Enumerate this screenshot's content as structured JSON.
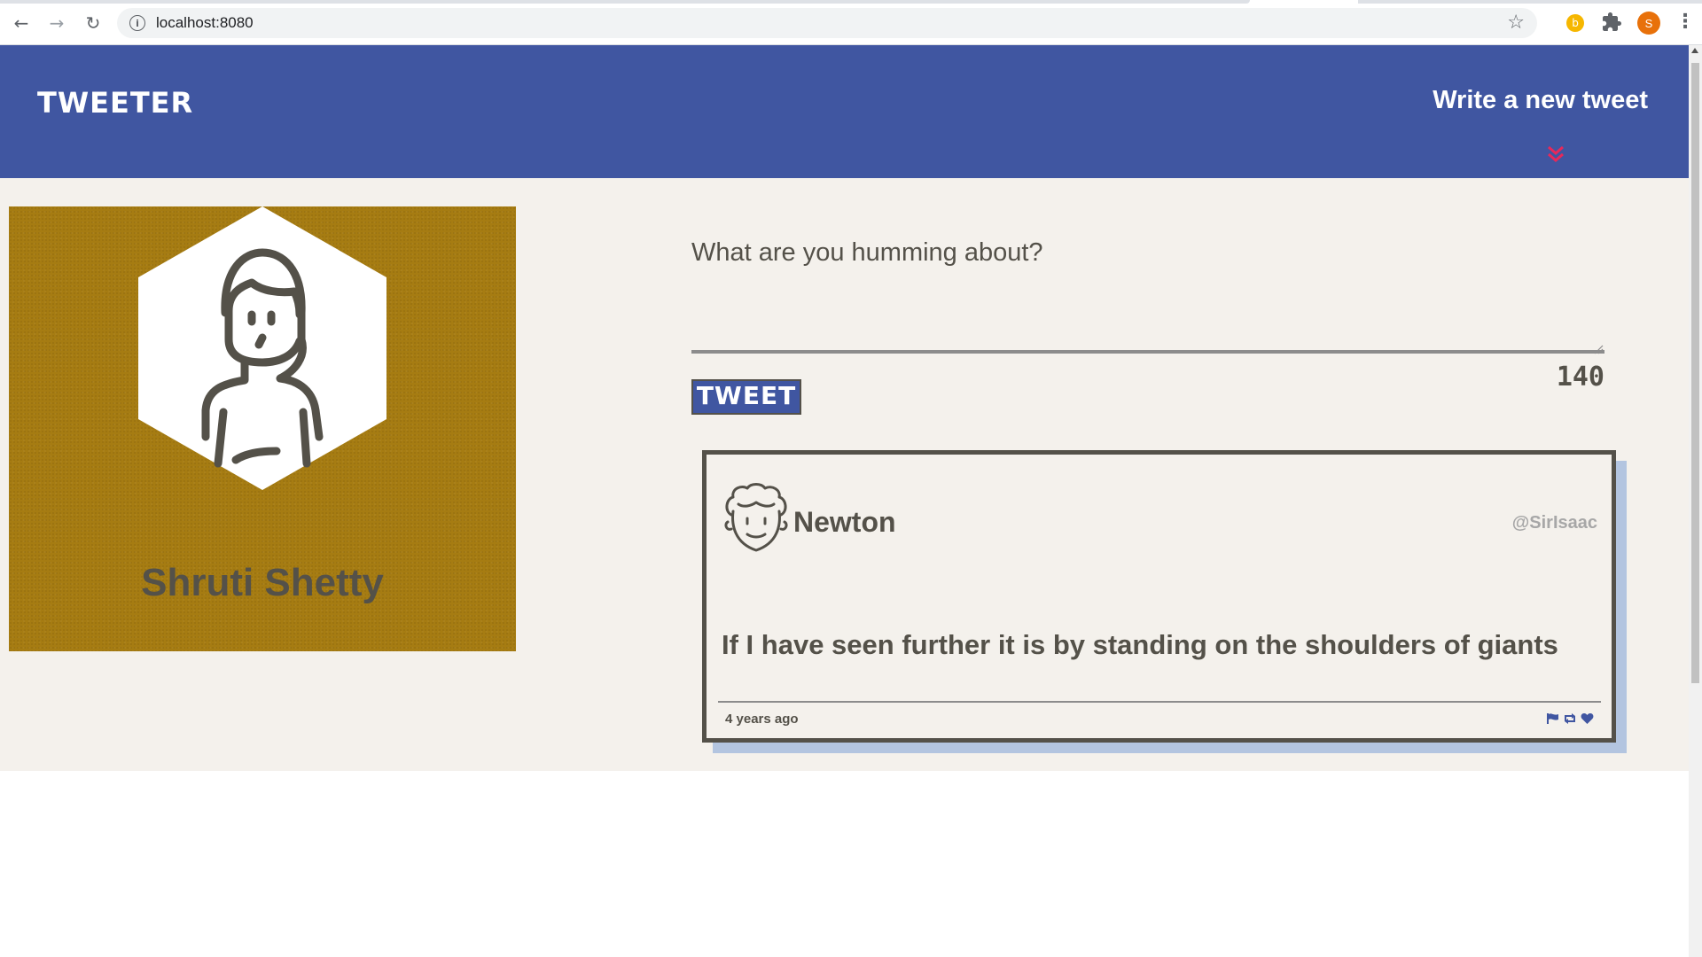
{
  "browser": {
    "url": "localhost:8080",
    "profile_initial": "S",
    "coin_label": "b"
  },
  "header": {
    "brand": "TWEETER",
    "write_tweet": "Write a new tweet",
    "accent_color": "#e8285a"
  },
  "profile": {
    "name": "Shruti Shetty",
    "card_color": "#a67c12"
  },
  "compose": {
    "placeholder": "What are you humming about?",
    "button_label": "TWEET",
    "counter": "140"
  },
  "tweets": [
    {
      "name": "Newton",
      "handle": "@SirIsaac",
      "text": "If I have seen further it is by standing on the shoulders of giants",
      "time": "4 years ago",
      "actions": [
        "flag-icon",
        "retweet-icon",
        "heart-icon"
      ]
    }
  ]
}
